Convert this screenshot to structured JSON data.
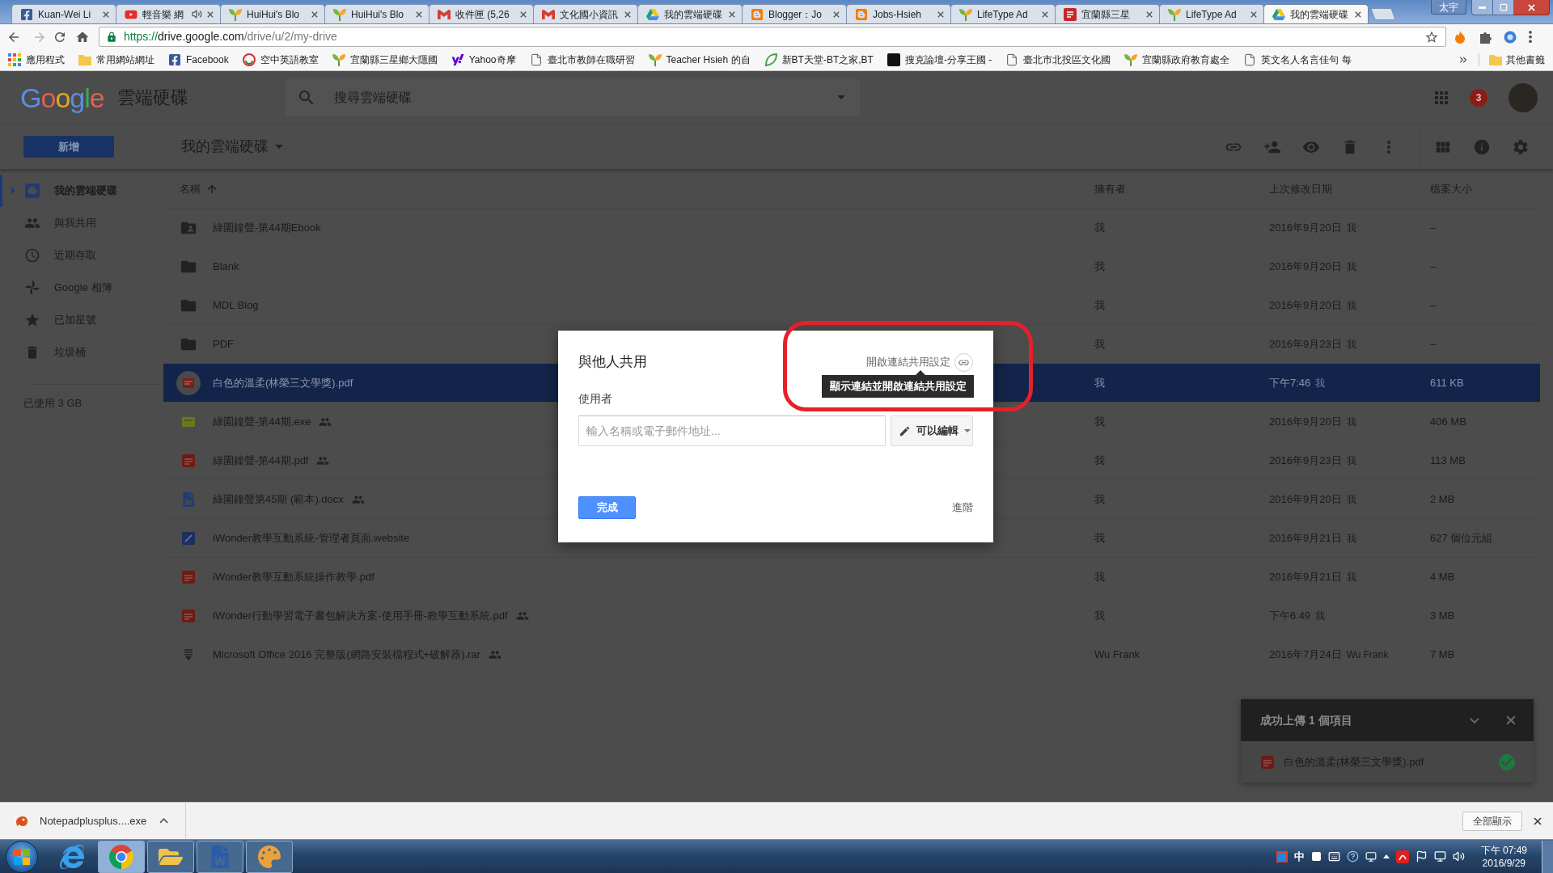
{
  "window": {
    "profile": "太宇"
  },
  "tabs": [
    {
      "title": "Kuan-Wei Li",
      "kind": "facebook",
      "audio": false,
      "selected": false
    },
    {
      "title": "輕音樂 網",
      "kind": "video",
      "audio": true,
      "selected": false
    },
    {
      "title": "HuiHui's Blo",
      "kind": "sprout",
      "audio": false,
      "selected": false
    },
    {
      "title": "HuiHui's Blo",
      "kind": "sprout",
      "audio": false,
      "selected": false
    },
    {
      "title": "收件匣 (5,26",
      "kind": "mail",
      "audio": false,
      "selected": false
    },
    {
      "title": "文化國小資訊",
      "kind": "mail",
      "audio": false,
      "selected": false
    },
    {
      "title": "我的雲端硬碟",
      "kind": "drive",
      "audio": false,
      "selected": false
    },
    {
      "title": "Blogger：Jo",
      "kind": "blogger",
      "audio": false,
      "selected": false
    },
    {
      "title": "Jobs-Hsieh",
      "kind": "blogger",
      "audio": false,
      "selected": false
    },
    {
      "title": "LifeType Ad",
      "kind": "sprout",
      "audio": false,
      "selected": false
    },
    {
      "title": "宜蘭縣三星",
      "kind": "pdf",
      "audio": false,
      "selected": false
    },
    {
      "title": "LifeType Ad",
      "kind": "sprout",
      "audio": false,
      "selected": false
    },
    {
      "title": "我的雲端硬碟",
      "kind": "drive",
      "audio": false,
      "selected": true
    }
  ],
  "toolbar": {
    "url": {
      "scheme": "https://",
      "host": "drive.google.com",
      "path": "/drive/u/2/my-drive"
    }
  },
  "bookmarks": {
    "items": [
      {
        "label": "應用程式",
        "kind": "apps"
      },
      {
        "label": "常用網站網址",
        "kind": "folder"
      },
      {
        "label": "Facebook",
        "kind": "facebook"
      },
      {
        "label": "空中英語教室",
        "kind": "swirl"
      },
      {
        "label": "宜蘭縣三星鄉大隱國",
        "kind": "sprout"
      },
      {
        "label": "Yahoo奇摩",
        "kind": "yahoo"
      },
      {
        "label": "臺北市教師在職研習",
        "kind": "page"
      },
      {
        "label": "Teacher Hsieh 的自",
        "kind": "sprout"
      },
      {
        "label": "新BT天堂-BT之家,BT",
        "kind": "leaf"
      },
      {
        "label": "搜克論壇-分享王國 -",
        "kind": "dark-square"
      },
      {
        "label": "臺北市北投區文化國",
        "kind": "page"
      },
      {
        "label": "宜蘭縣政府教育處全",
        "kind": "sprout"
      },
      {
        "label": "英文名人名言佳句 每",
        "kind": "page"
      }
    ],
    "other": "其他書籤"
  },
  "drive": {
    "logo": "Google",
    "product": "雲端硬碟",
    "search": {
      "placeholder": "搜尋雲端硬碟"
    },
    "notifications": "3",
    "new_button": "新增",
    "location": "我的雲端硬碟",
    "sidebar": {
      "items": [
        {
          "label": "我的雲端硬碟",
          "kind": "drive",
          "expandable": true,
          "selected": true
        },
        {
          "label": "與我共用",
          "kind": "shared",
          "expandable": false,
          "selected": false
        },
        {
          "label": "近期存取",
          "kind": "recent",
          "expandable": false,
          "selected": false
        },
        {
          "label": "Google 相簿",
          "kind": "photos",
          "expandable": false,
          "selected": false
        },
        {
          "label": "已加星號",
          "kind": "starred",
          "expandable": false,
          "selected": false
        },
        {
          "label": "垃圾桶",
          "kind": "trash",
          "expandable": false,
          "selected": false
        }
      ],
      "storage": "已使用 3 GB"
    },
    "files": {
      "columns": [
        {
          "label": "名稱",
          "sorted": true
        },
        {
          "label": "擁有者",
          "sorted": false
        },
        {
          "label": "上次修改日期",
          "sorted": false
        },
        {
          "label": "檔案大小",
          "sorted": false
        }
      ],
      "rows": [
        {
          "name": "綠園鐘聲-第44期Ebook",
          "kind": "shared-folder",
          "shared": false,
          "owner": "我",
          "modified": "2016年9月20日",
          "modified_by": "我",
          "size": "–",
          "selected": false
        },
        {
          "name": "Blank",
          "kind": "folder",
          "shared": false,
          "owner": "我",
          "modified": "2016年9月20日",
          "modified_by": "我",
          "size": "–",
          "selected": false
        },
        {
          "name": "MDL Blog",
          "kind": "folder",
          "shared": false,
          "owner": "我",
          "modified": "2016年9月20日",
          "modified_by": "我",
          "size": "–",
          "selected": false
        },
        {
          "name": "PDF",
          "kind": "folder",
          "shared": false,
          "owner": "我",
          "modified": "2016年9月23日",
          "modified_by": "我",
          "size": "–",
          "selected": false
        },
        {
          "name": "白色的溫柔(林榮三文學獎).pdf",
          "kind": "pdf",
          "shared": false,
          "owner": "我",
          "modified": "下午7:46",
          "modified_by": "我",
          "size": "611 KB",
          "selected": true
        },
        {
          "name": "綠園鐘聲-第44期.exe",
          "kind": "exe",
          "shared": true,
          "owner": "我",
          "modified": "2016年9月20日",
          "modified_by": "我",
          "size": "406 MB",
          "selected": false
        },
        {
          "name": "綠園鐘聲-第44期.pdf",
          "kind": "pdf",
          "shared": true,
          "owner": "我",
          "modified": "2016年9月23日",
          "modified_by": "我",
          "size": "113 MB",
          "selected": false
        },
        {
          "name": "綠園鐘聲第45期 (範本).docx",
          "kind": "word",
          "shared": true,
          "owner": "我",
          "modified": "2016年9月20日",
          "modified_by": "我",
          "size": "2 MB",
          "selected": false
        },
        {
          "name": "iWonder教學互動系統-管理者頁面.website",
          "kind": "website",
          "shared": false,
          "owner": "我",
          "modified": "2016年9月21日",
          "modified_by": "我",
          "size": "627 個位元組",
          "selected": false
        },
        {
          "name": "iWonder教學互動系統操作教學.pdf",
          "kind": "pdf",
          "shared": false,
          "owner": "我",
          "modified": "2016年9月21日",
          "modified_by": "我",
          "size": "4 MB",
          "selected": false
        },
        {
          "name": "iWonder行動學習電子書包解決方案-使用手冊-教學互動系統.pdf",
          "kind": "pdf",
          "shared": true,
          "owner": "我",
          "modified": "下午6:49",
          "modified_by": "我",
          "size": "3 MB",
          "selected": false
        },
        {
          "name": "Microsoft Office 2016 完整版(網路安裝檔程式+破解器).rar",
          "kind": "archive",
          "shared": true,
          "owner": "Wu Frank",
          "modified": "2016年7月24日",
          "modified_by": "Wu Frank",
          "size": "7 MB",
          "selected": false
        }
      ]
    }
  },
  "dialog": {
    "title": "與他人共用",
    "link_sharing": "開啟連結共用設定",
    "tooltip": "顯示連結並開啟連結共用設定",
    "people_label": "使用者",
    "people_input": {
      "placeholder": "輸入名稱或電子郵件地址..."
    },
    "permission": "可以編輯",
    "done": "完成",
    "advanced": "進階"
  },
  "upload": {
    "title": "成功上傳 1 個項目",
    "items": [
      {
        "name": "白色的溫柔(林榮三文學獎).pdf",
        "kind": "pdf",
        "done": true
      }
    ]
  },
  "download": {
    "file": "Notepadplusplus....exe",
    "show_all": "全部顯示"
  },
  "taskbar": {
    "apps": [
      {
        "kind": "ie",
        "running": false,
        "selected": false
      },
      {
        "kind": "chrome",
        "running": true,
        "selected": true
      },
      {
        "kind": "explorer",
        "running": true,
        "selected": false
      },
      {
        "kind": "word",
        "running": true,
        "selected": false
      },
      {
        "kind": "paint",
        "running": true,
        "selected": false
      }
    ],
    "ime": "中",
    "time": "下午 07:49",
    "date": "2016/9/29"
  }
}
